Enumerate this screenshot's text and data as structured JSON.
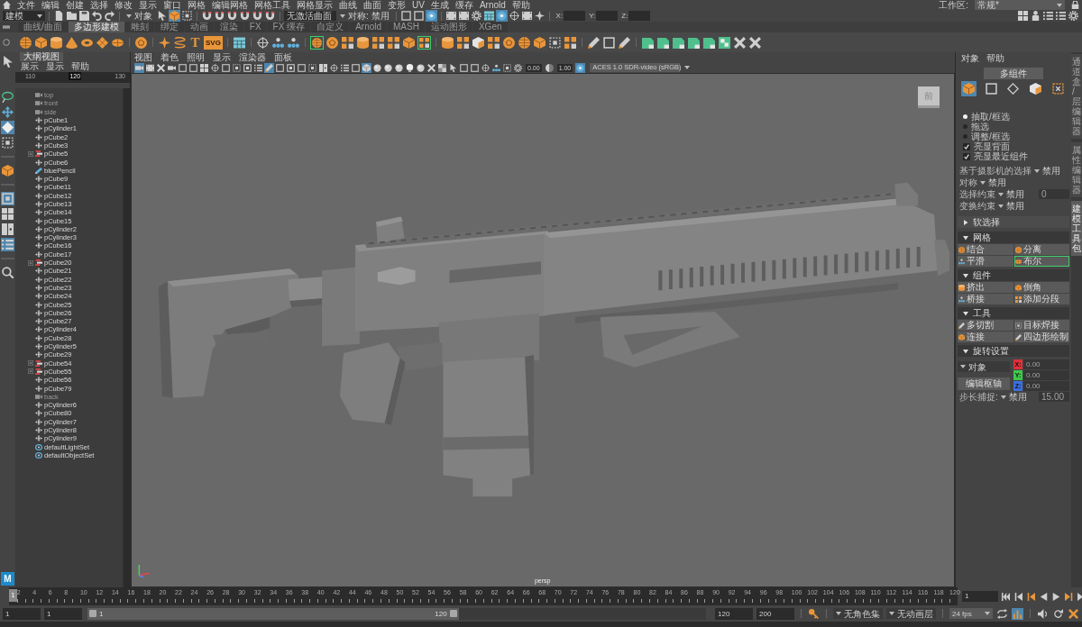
{
  "menu_bar": {
    "items": [
      "文件",
      "编辑",
      "创建",
      "选择",
      "修改",
      "显示",
      "窗口",
      "网格",
      "编辑网格",
      "网格工具",
      "网格显示",
      "曲线",
      "曲面",
      "变形",
      "UV",
      "生成",
      "缓存",
      "Arnold",
      "帮助"
    ],
    "workspace_label": "工作区:",
    "workspace": "常规*"
  },
  "status_line": {
    "menu_set": "建模",
    "selection_mode": "对象",
    "toggles": [
      {
        "on": false
      },
      {
        "on": true
      },
      {
        "on": false
      },
      {
        "on": false
      },
      {
        "on": false
      },
      {
        "on": false
      },
      {
        "on": false
      },
      {
        "on": false
      },
      {
        "on": false
      },
      {
        "on": false
      },
      {
        "on": false
      },
      {
        "on": true
      },
      {
        "on": false
      },
      {
        "on": false
      },
      {
        "on": false
      },
      {
        "on": false
      },
      {
        "on": true
      },
      {
        "on": false
      },
      {
        "on": false
      },
      {
        "on": false
      }
    ],
    "live_surface": "无激活曲面",
    "symmetry": "对称: 禁用",
    "axis_labels": [
      "X:",
      "Y:",
      "Z:"
    ]
  },
  "shelf": {
    "tabs": [
      {
        "label": "曲线/曲面",
        "selected": false
      },
      {
        "label": "多边形建模",
        "selected": true
      },
      {
        "label": "雕刻",
        "selected": false
      },
      {
        "label": "绑定",
        "selected": false
      },
      {
        "label": "动画",
        "selected": false
      },
      {
        "label": "渲染",
        "selected": false
      },
      {
        "label": "FX",
        "selected": false
      },
      {
        "label": "FX 缓存",
        "selected": false
      },
      {
        "label": "自定义",
        "selected": false
      },
      {
        "label": "Arnold",
        "selected": false
      },
      {
        "label": "MASH",
        "selected": false
      },
      {
        "label": "运动图形",
        "selected": false
      },
      {
        "label": "XGen",
        "selected": false
      }
    ],
    "type_glyph": "T",
    "svg_label": "SVG"
  },
  "toolbox": {
    "tools": [
      {
        "selected": false
      },
      {
        "selected": false
      },
      {
        "selected": false
      },
      {
        "selected": true
      },
      {
        "selected": false
      },
      {
        "selected": false
      },
      {
        "selected": true
      },
      {
        "selected": false
      },
      {
        "selected": false
      },
      {
        "selected": true
      },
      {
        "selected": false
      }
    ],
    "logo": "M"
  },
  "outliner": {
    "title": "大纲视图",
    "menus": [
      "展示",
      "显示",
      "帮助"
    ],
    "ruler": [
      {
        "label": "110",
        "selected": false
      },
      {
        "label": "120",
        "selected": true
      },
      {
        "label": "130",
        "selected": false
      }
    ],
    "items": [
      {
        "label": "top",
        "kind": "camera",
        "hidden": true
      },
      {
        "label": "front",
        "kind": "camera",
        "hidden": true
      },
      {
        "label": "side",
        "kind": "camera",
        "hidden": true
      },
      {
        "label": "pCube1",
        "kind": "mesh",
        "hidden": false
      },
      {
        "label": "pCylinder1",
        "kind": "mesh",
        "hidden": false
      },
      {
        "label": "pCube2",
        "kind": "mesh",
        "hidden": false
      },
      {
        "label": "pCube3",
        "kind": "mesh",
        "hidden": false
      },
      {
        "label": "pCube5",
        "kind": "group",
        "hidden": false,
        "expanded": false
      },
      {
        "label": "pCube6",
        "kind": "mesh",
        "hidden": false
      },
      {
        "label": "bluePencil",
        "kind": "pencil",
        "hidden": false
      },
      {
        "label": "pCube9",
        "kind": "mesh",
        "hidden": false
      },
      {
        "label": "pCube11",
        "kind": "mesh",
        "hidden": false
      },
      {
        "label": "pCube12",
        "kind": "mesh",
        "hidden": false
      },
      {
        "label": "pCube13",
        "kind": "mesh",
        "hidden": false
      },
      {
        "label": "pCube14",
        "kind": "mesh",
        "hidden": false
      },
      {
        "label": "pCube15",
        "kind": "mesh",
        "hidden": false
      },
      {
        "label": "pCylinder2",
        "kind": "mesh",
        "hidden": false
      },
      {
        "label": "pCylinder3",
        "kind": "mesh",
        "hidden": false
      },
      {
        "label": "pCube16",
        "kind": "mesh",
        "hidden": false
      },
      {
        "label": "pCube17",
        "kind": "mesh",
        "hidden": false
      },
      {
        "label": "pCube20",
        "kind": "group",
        "hidden": false,
        "expanded": false
      },
      {
        "label": "pCube21",
        "kind": "mesh",
        "hidden": false
      },
      {
        "label": "pCube22",
        "kind": "mesh",
        "hidden": false
      },
      {
        "label": "pCube23",
        "kind": "mesh",
        "hidden": false
      },
      {
        "label": "pCube24",
        "kind": "mesh",
        "hidden": false
      },
      {
        "label": "pCube25",
        "kind": "mesh",
        "hidden": false
      },
      {
        "label": "pCube26",
        "kind": "mesh",
        "hidden": false
      },
      {
        "label": "pCube27",
        "kind": "mesh",
        "hidden": false
      },
      {
        "label": "pCylinder4",
        "kind": "mesh",
        "hidden": false
      },
      {
        "label": "pCube28",
        "kind": "mesh",
        "hidden": false
      },
      {
        "label": "pCylinder5",
        "kind": "mesh",
        "hidden": false
      },
      {
        "label": "pCube29",
        "kind": "mesh",
        "hidden": false
      },
      {
        "label": "pCube54",
        "kind": "group",
        "hidden": false,
        "expanded": false
      },
      {
        "label": "pCube55",
        "kind": "group",
        "hidden": false,
        "expanded": false
      },
      {
        "label": "pCube56",
        "kind": "mesh",
        "hidden": false
      },
      {
        "label": "pCube79",
        "kind": "mesh",
        "hidden": false
      },
      {
        "label": "back",
        "kind": "camera",
        "hidden": true
      },
      {
        "label": "pCylinder6",
        "kind": "mesh",
        "hidden": false
      },
      {
        "label": "pCube80",
        "kind": "mesh",
        "hidden": false
      },
      {
        "label": "pCylinder7",
        "kind": "mesh",
        "hidden": false
      },
      {
        "label": "pCylinder8",
        "kind": "mesh",
        "hidden": false
      },
      {
        "label": "pCylinder9",
        "kind": "mesh",
        "hidden": false
      },
      {
        "label": "defaultLightSet",
        "kind": "set",
        "hidden": false
      },
      {
        "label": "defaultObjectSet",
        "kind": "set",
        "hidden": false
      }
    ]
  },
  "viewport": {
    "menus": [
      "视图",
      "着色",
      "照明",
      "显示",
      "渲染器",
      "面板"
    ],
    "toolbar": [
      {
        "on": true
      },
      {
        "on": false
      },
      {
        "on": false
      },
      {
        "on": false
      },
      {
        "on": false
      },
      {
        "on": false
      },
      {
        "on": false
      },
      {
        "on": false
      },
      {
        "on": false
      },
      {
        "on": false
      },
      {
        "on": false
      },
      {
        "on": false
      },
      {
        "on": true
      },
      {
        "on": false
      },
      {
        "on": false
      },
      {
        "on": false
      },
      {
        "on": false
      },
      {
        "on": false
      },
      {
        "on": false
      },
      {
        "on": false
      },
      {
        "on": false
      },
      {
        "on": true
      },
      {
        "on": false
      },
      {
        "on": false
      },
      {
        "on": false
      },
      {
        "on": false
      },
      {
        "on": false
      },
      {
        "on": false
      },
      {
        "on": false
      },
      {
        "on": false
      },
      {
        "on": false
      },
      {
        "on": false
      },
      {
        "on": false
      },
      {
        "on": false
      },
      {
        "on": false
      },
      {
        "on": false
      },
      {
        "on": false
      },
      {
        "on": true
      }
    ],
    "exposure": "0.00",
    "gamma": "1.00",
    "color_space": "ACES 1.0 SDR-video (sRGB)",
    "view_cube": "前",
    "camera": "persp"
  },
  "modeling_toolkit": {
    "menus": [
      "对象",
      "帮助"
    ],
    "mode_button": "多组件",
    "component_modes": [
      {
        "selected": true
      },
      {
        "selected": false
      },
      {
        "selected": false
      },
      {
        "selected": false
      },
      {
        "selected": false
      }
    ],
    "pick_modes": [
      {
        "label": "抽取/框选",
        "selected": true
      },
      {
        "label": "拖选",
        "selected": false
      },
      {
        "label": "调整/框选",
        "selected": false
      }
    ],
    "options": [
      {
        "label": "亮显背面",
        "checked": true
      },
      {
        "label": "亮显最近组件",
        "checked": true
      }
    ],
    "settings": [
      {
        "label": "基于摄影机的选择",
        "value": "禁用"
      },
      {
        "label": "对称",
        "value": "禁用"
      },
      {
        "label": "选择约束",
        "value": "禁用",
        "field": "0"
      },
      {
        "label": "变换约束",
        "value": "禁用"
      }
    ],
    "sections": [
      {
        "title": "软选择",
        "expanded": false
      },
      {
        "title": "网格",
        "expanded": true,
        "buttons": [
          {
            "label": "结合",
            "highlighted": false
          },
          {
            "label": "分离",
            "highlighted": false
          },
          {
            "label": "平滑",
            "highlighted": false
          },
          {
            "label": "布尔",
            "highlighted": true
          }
        ]
      },
      {
        "title": "组件",
        "expanded": true,
        "buttons": [
          {
            "label": "挤出",
            "highlighted": false
          },
          {
            "label": "倒角",
            "highlighted": false
          },
          {
            "label": "桥接",
            "highlighted": false
          },
          {
            "label": "添加分段",
            "highlighted": false
          }
        ]
      },
      {
        "title": "工具",
        "expanded": true,
        "buttons": [
          {
            "label": "多切割",
            "highlighted": false
          },
          {
            "label": "目标焊接",
            "highlighted": false
          },
          {
            "label": "连接",
            "highlighted": false
          },
          {
            "label": "四边形绘制",
            "highlighted": false
          }
        ]
      },
      {
        "title": "旋转设置",
        "expanded": true,
        "pivot": {
          "space": "对象",
          "axes": [
            {
              "label": "X:",
              "value": "0.00",
              "color": "#e0303a"
            },
            {
              "label": "Y:",
              "value": "0.00",
              "color": "#3ec84a"
            },
            {
              "label": "Z:",
              "value": "0.00",
              "color": "#3a6fe0"
            }
          ],
          "edit_button": "编辑枢轴",
          "step_label": "步长捕捉:",
          "step_value": "禁用",
          "step_field": "15.00"
        }
      }
    ]
  },
  "side_tabs": [
    {
      "label": "通道盒/层编辑器",
      "selected": false
    },
    {
      "label": "属性编辑器",
      "selected": false
    },
    {
      "label": "建模工具包",
      "selected": true
    }
  ],
  "time_slider": {
    "labels": [
      "2",
      "4",
      "6",
      "8",
      "10",
      "12",
      "14",
      "16",
      "18",
      "20",
      "22",
      "24",
      "26",
      "28",
      "30",
      "32",
      "34",
      "36",
      "38",
      "40",
      "42",
      "44",
      "46",
      "48",
      "50",
      "52",
      "54",
      "56",
      "58",
      "60",
      "62",
      "64",
      "66",
      "68",
      "70",
      "72",
      "74",
      "76",
      "78",
      "80",
      "82",
      "84",
      "86",
      "88",
      "90",
      "92",
      "94",
      "96",
      "98",
      "100",
      "102",
      "104",
      "106",
      "108",
      "110",
      "112",
      "114",
      "116",
      "118",
      "120"
    ],
    "current_frame": "1",
    "frame_field": "1"
  },
  "range_slider": {
    "start": "1",
    "playback_start": "1",
    "range_start": "1",
    "range_end": "120",
    "level": 0.6,
    "playback_end": "120",
    "end": "200",
    "character_set": "无角色集",
    "anim_layer": "无动画层",
    "fps": "24 fps",
    "toggles": [
      {
        "on": false
      },
      {
        "on": true
      }
    ]
  }
}
